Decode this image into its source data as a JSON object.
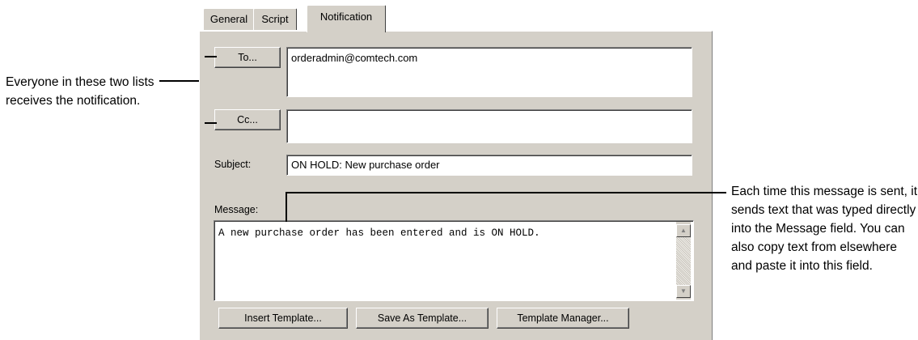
{
  "callouts": {
    "left": "Everyone in these two lists receives the notification.",
    "right": "Each time this message is sent, it sends text that was typed directly into the Message field. You can also copy text from elsewhere and paste it into this field."
  },
  "tabs": [
    {
      "label": "General"
    },
    {
      "label": "Script"
    },
    {
      "label": "Notification",
      "active": true
    }
  ],
  "recipients": {
    "to_button": "To...",
    "to_value": "orderadmin@comtech.com",
    "cc_button": "Cc...",
    "cc_value": ""
  },
  "subject": {
    "label": "Subject:",
    "value": "ON HOLD: New purchase order"
  },
  "message": {
    "label": "Message:",
    "value": "A new purchase order has been entered and is ON HOLD."
  },
  "buttons": {
    "insert_template": "Insert Template...",
    "save_as_template": "Save As Template...",
    "template_manager": "Template Manager..."
  },
  "icons": {
    "scroll_up": "scroll-up-arrow-icon",
    "scroll_down": "scroll-down-arrow-icon"
  }
}
